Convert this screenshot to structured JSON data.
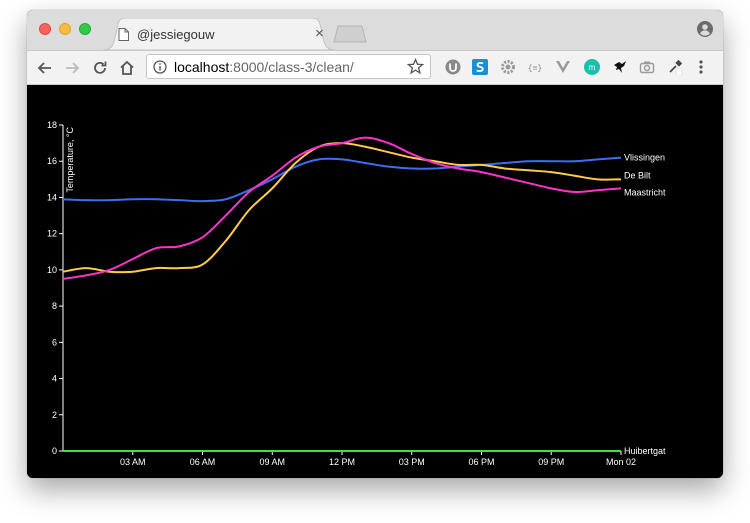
{
  "browser": {
    "tab_title": "@jessiegouw",
    "tab_close": "×",
    "url_host": "localhost",
    "url_rest": ":8000/class-3/clean/"
  },
  "chart_data": {
    "type": "line",
    "ylabel": "Temperature, °C",
    "xlabel": "",
    "ylim": [
      0,
      18
    ],
    "yticks": [
      0,
      2,
      4,
      6,
      8,
      10,
      12,
      14,
      16,
      18
    ],
    "x_range_hours": [
      0,
      24
    ],
    "xticks": [
      {
        "hour": 3,
        "label": "03 AM"
      },
      {
        "hour": 6,
        "label": "06 AM"
      },
      {
        "hour": 9,
        "label": "09 AM"
      },
      {
        "hour": 12,
        "label": "12 PM"
      },
      {
        "hour": 15,
        "label": "03 PM"
      },
      {
        "hour": 18,
        "label": "06 PM"
      },
      {
        "hour": 21,
        "label": "09 PM"
      },
      {
        "hour": 24,
        "label": "Mon 02"
      }
    ],
    "grid": false,
    "series": [
      {
        "name": "Vlissingen",
        "color": "#3b6ef5",
        "x": [
          0,
          1,
          2,
          3,
          4,
          5,
          6,
          7,
          8,
          9,
          10,
          11,
          12,
          13,
          14,
          15,
          16,
          17,
          18,
          19,
          20,
          21,
          22,
          23,
          24
        ],
        "y": [
          13.9,
          13.85,
          13.85,
          13.9,
          13.9,
          13.85,
          13.8,
          13.9,
          14.4,
          15.0,
          15.7,
          16.1,
          16.1,
          15.9,
          15.7,
          15.6,
          15.6,
          15.7,
          15.8,
          15.9,
          16.0,
          16.0,
          16.0,
          16.1,
          16.2
        ]
      },
      {
        "name": "De Bilt",
        "color": "#ffcc44",
        "x": [
          0,
          1,
          2,
          3,
          4,
          5,
          6,
          7,
          8,
          9,
          10,
          11,
          12,
          13,
          14,
          15,
          16,
          17,
          18,
          19,
          20,
          21,
          22,
          23,
          24
        ],
        "y": [
          9.9,
          10.1,
          9.9,
          9.9,
          10.1,
          10.1,
          10.3,
          11.6,
          13.3,
          14.5,
          15.9,
          16.8,
          17.0,
          16.8,
          16.5,
          16.2,
          16.0,
          15.8,
          15.8,
          15.6,
          15.5,
          15.4,
          15.2,
          15.0,
          15.0
        ]
      },
      {
        "name": "Maastricht",
        "color": "#ff33cc",
        "x": [
          0,
          1,
          2,
          3,
          4,
          5,
          6,
          7,
          8,
          9,
          10,
          11,
          12,
          13,
          14,
          15,
          16,
          17,
          18,
          19,
          20,
          21,
          22,
          23,
          24
        ],
        "y": [
          9.5,
          9.7,
          10.0,
          10.6,
          11.2,
          11.3,
          11.8,
          13.0,
          14.3,
          15.2,
          16.2,
          16.8,
          17.0,
          17.3,
          17.0,
          16.4,
          15.9,
          15.6,
          15.4,
          15.1,
          14.8,
          14.5,
          14.3,
          14.4,
          14.5
        ]
      },
      {
        "name": "Huibertgat",
        "color": "#44dd44",
        "x": [
          0,
          24
        ],
        "y": [
          0,
          0
        ]
      }
    ]
  }
}
